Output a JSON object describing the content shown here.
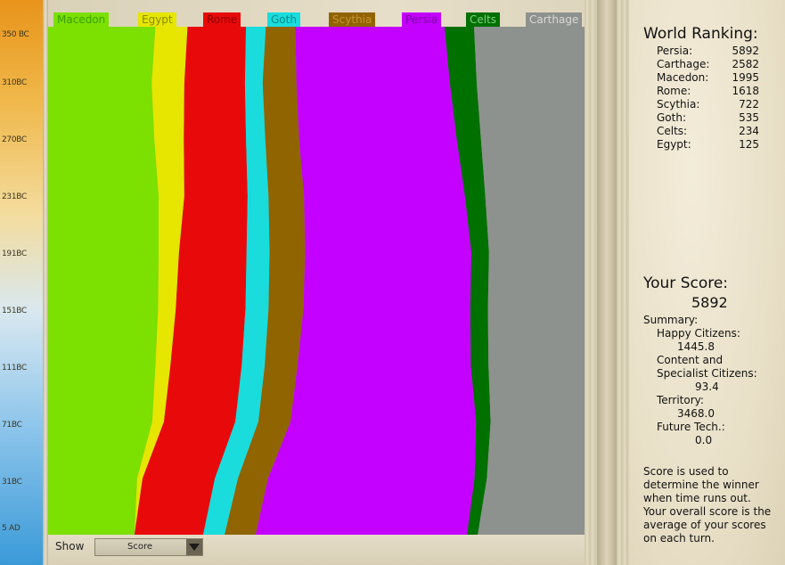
{
  "timeline": {
    "ticks": [
      "350 BC",
      "310BC",
      "270BC",
      "231BC",
      "191BC",
      "151BC",
      "111BC",
      "71BC",
      "31BC",
      "5 AD"
    ]
  },
  "tabs": [
    {
      "label": "Macedon",
      "color": "#7ce000",
      "text_color": "#3aa000"
    },
    {
      "label": "Egypt",
      "color": "#e6e600",
      "text_color": "#8a8a00"
    },
    {
      "label": "Rome",
      "color": "#e80a0a",
      "text_color": "#8a0000"
    },
    {
      "label": "Goth",
      "color": "#1adcdc",
      "text_color": "#0a8a8a"
    },
    {
      "label": "Scythia",
      "color": "#906400",
      "text_color": "#c89430"
    },
    {
      "label": "Persia",
      "color": "#c400ff",
      "text_color": "#7a00a0"
    },
    {
      "label": "Celts",
      "color": "#007000",
      "text_color": "#80d080"
    },
    {
      "label": "Carthage",
      "color": "#8e928e",
      "text_color": "#d8d8d8"
    }
  ],
  "chart_data": {
    "type": "area",
    "title": "",
    "xlabel": "",
    "ylabel": "",
    "time_axis": [
      "350 BC",
      "310BC",
      "270BC",
      "231BC",
      "191BC",
      "151BC",
      "111BC",
      "71BC",
      "31BC",
      "5 AD"
    ],
    "series": [
      {
        "name": "Macedon",
        "share_pct": [
          20.0,
          19.3,
          19.8,
          20.6,
          20.6,
          20.5,
          20.0,
          19.4,
          16.6,
          16.1
        ]
      },
      {
        "name": "Egypt",
        "share_pct": [
          6.0,
          6.1,
          5.5,
          4.8,
          3.8,
          3.3,
          2.8,
          2.2,
          1.0,
          0.0
        ]
      },
      {
        "name": "Rome",
        "share_pct": [
          10.9,
          11.3,
          11.6,
          11.8,
          12.6,
          13.0,
          13.3,
          13.3,
          13.5,
          12.8
        ]
      },
      {
        "name": "Goth",
        "share_pct": [
          3.7,
          3.3,
          3.6,
          3.9,
          4.3,
          4.3,
          4.3,
          4.3,
          4.3,
          4.0
        ]
      },
      {
        "name": "Scythia",
        "share_pct": [
          5.5,
          6.3,
          6.3,
          6.6,
          6.6,
          6.5,
          6.1,
          6.0,
          5.6,
          5.8
        ]
      },
      {
        "name": "Persia",
        "share_pct": [
          27.8,
          28.6,
          29.4,
          30.0,
          31.0,
          31.1,
          32.3,
          34.6,
          38.5,
          39.4
        ]
      },
      {
        "name": "Celts",
        "share_pct": [
          5.5,
          5.0,
          4.5,
          3.8,
          3.3,
          3.3,
          3.3,
          2.7,
          2.3,
          2.0
        ]
      },
      {
        "name": "Carthage",
        "share_pct": [
          20.6,
          20.1,
          19.3,
          18.5,
          17.8,
          18.0,
          17.9,
          17.5,
          18.2,
          19.9
        ]
      }
    ]
  },
  "bottom": {
    "show_label": "Show",
    "show_value": "Score"
  },
  "ranking": {
    "title": "World Ranking:",
    "rows": [
      {
        "name": "Persia:",
        "score": "5892"
      },
      {
        "name": "Carthage:",
        "score": "2582"
      },
      {
        "name": "Macedon:",
        "score": "1995"
      },
      {
        "name": "Rome:",
        "score": "1618"
      },
      {
        "name": "Scythia:",
        "score": "722"
      },
      {
        "name": "Goth:",
        "score": "535"
      },
      {
        "name": "Celts:",
        "score": "234"
      },
      {
        "name": "Egypt:",
        "score": "125"
      }
    ]
  },
  "score": {
    "title": "Your Score:",
    "value": "5892",
    "summary_label": "Summary:",
    "happy_label": "Happy Citizens:",
    "happy_value": "1445.8",
    "content_label_1": "Content and",
    "content_label_2": "Specialist Citizens:",
    "content_value": "93.4",
    "territory_label": "Territory:",
    "territory_value": "3468.0",
    "future_label": "Future Tech.:",
    "future_value": "0.0"
  },
  "note": "Score is used to determine the winner when time runs out. Your overall score is the average of your scores on each turn."
}
